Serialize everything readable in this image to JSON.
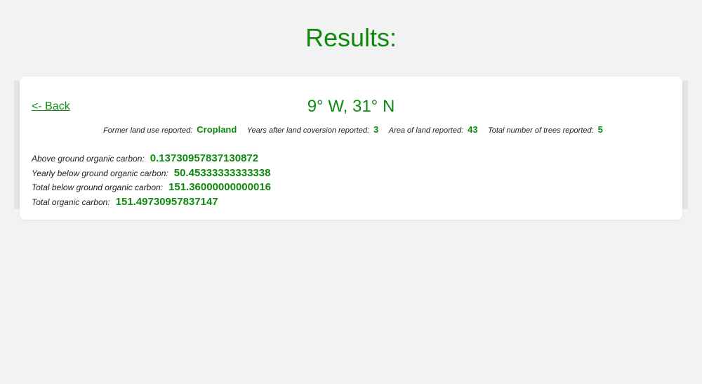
{
  "page": {
    "title": "Results:"
  },
  "card": {
    "back_label": "<- Back",
    "coordinates": "9° W, 31° N",
    "meta": [
      {
        "label": "Former land use reported:",
        "value": "Cropland"
      },
      {
        "label": "Years after land coversion reported:",
        "value": "3"
      },
      {
        "label": "Area of land reported:",
        "value": "43"
      },
      {
        "label": "Total number of trees reported:",
        "value": "5"
      }
    ],
    "results": [
      {
        "label": "Above ground organic carbon:",
        "value": "0.13730957837130872"
      },
      {
        "label": "Yearly below ground organic carbon:",
        "value": "50.45333333333338"
      },
      {
        "label": "Total below ground organic carbon:",
        "value": "151.36000000000016"
      },
      {
        "label": "Total organic carbon:",
        "value": "151.49730957837147"
      }
    ]
  },
  "colors": {
    "accent": "#0f8a0f",
    "background": "#f2f2f2",
    "card": "#ffffff"
  }
}
